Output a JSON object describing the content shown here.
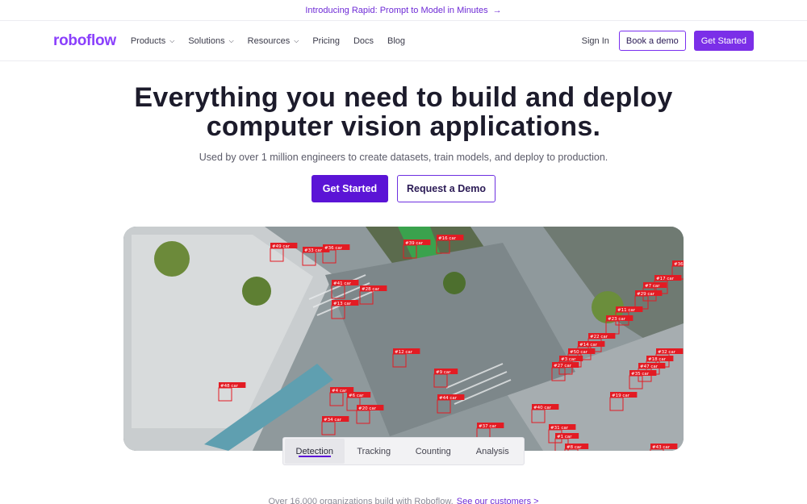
{
  "announcement": {
    "text": "Introducing Rapid: Prompt to Model in Minutes",
    "arrow": "→"
  },
  "nav": {
    "logo": "roboflow",
    "links": [
      {
        "label": "Products",
        "dropdown": true
      },
      {
        "label": "Solutions",
        "dropdown": true
      },
      {
        "label": "Resources",
        "dropdown": true
      },
      {
        "label": "Pricing",
        "dropdown": false
      },
      {
        "label": "Docs",
        "dropdown": false
      },
      {
        "label": "Blog",
        "dropdown": false
      }
    ],
    "sign_in": "Sign In",
    "book_demo": "Book a demo",
    "get_started": "Get Started"
  },
  "hero": {
    "headline_line1": "Everything you need to build and deploy",
    "headline_line2": "computer vision applications.",
    "subtitle": "Used by over 1 million engineers to create datasets, train models, and deploy to production.",
    "primary_cta": "Get Started",
    "secondary_cta": "Request a Demo"
  },
  "detections": [
    "#49 car",
    "#33 car",
    "#36 car",
    "#41 car",
    "#28 car",
    "#13 car",
    "#39 car",
    "#16 car",
    "#12 car",
    "#9 car",
    "#44 car",
    "#4 car",
    "#6 car",
    "#20 car",
    "#34 car",
    "#48 car",
    "#37 car",
    "#36",
    "#17 car",
    "#7 car",
    "#29 car",
    "#11 car",
    "#23 car",
    "#22 car",
    "#14 car",
    "#50 car",
    "#3 car",
    "#27 car",
    "#32 car",
    "#18 car",
    "#47 car",
    "#35 car",
    "#19 car",
    "#40 car",
    "#31 car",
    "#1 car",
    "#8 car",
    "#43 car"
  ],
  "tabs": [
    "Detection",
    "Tracking",
    "Counting",
    "Analysis"
  ],
  "active_tab": "Detection",
  "footer": {
    "text": "Over 16,000 organizations build with Roboflow.",
    "link": "See our customers >"
  },
  "colors": {
    "brand": "#7b2fe8",
    "cta": "#5b14d6",
    "detection": "#e31b23"
  }
}
